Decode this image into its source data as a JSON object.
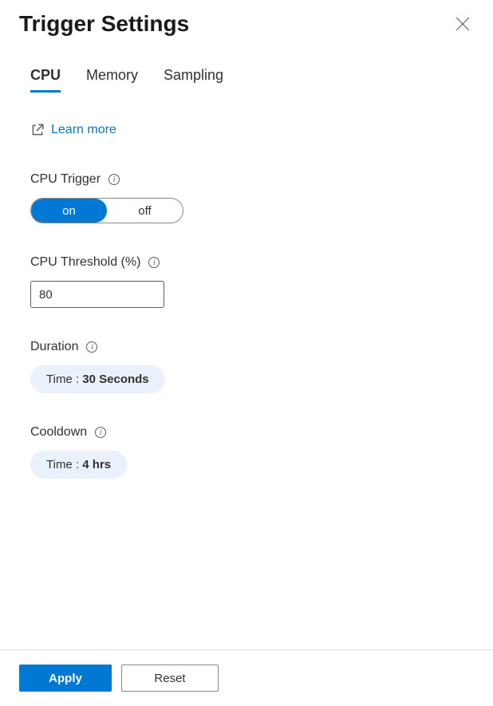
{
  "header": {
    "title": "Trigger Settings"
  },
  "tabs": [
    {
      "label": "CPU",
      "active": true
    },
    {
      "label": "Memory",
      "active": false
    },
    {
      "label": "Sampling",
      "active": false
    }
  ],
  "learnMore": {
    "label": "Learn more"
  },
  "fields": {
    "cpuTrigger": {
      "label": "CPU Trigger",
      "options": {
        "on": "on",
        "off": "off"
      },
      "value": "on"
    },
    "cpuThreshold": {
      "label": "CPU Threshold (%)",
      "value": "80"
    },
    "duration": {
      "label": "Duration",
      "pillPrefix": "Time : ",
      "value": "30 Seconds"
    },
    "cooldown": {
      "label": "Cooldown",
      "pillPrefix": "Time : ",
      "value": "4 hrs"
    }
  },
  "footer": {
    "apply": "Apply",
    "reset": "Reset"
  }
}
